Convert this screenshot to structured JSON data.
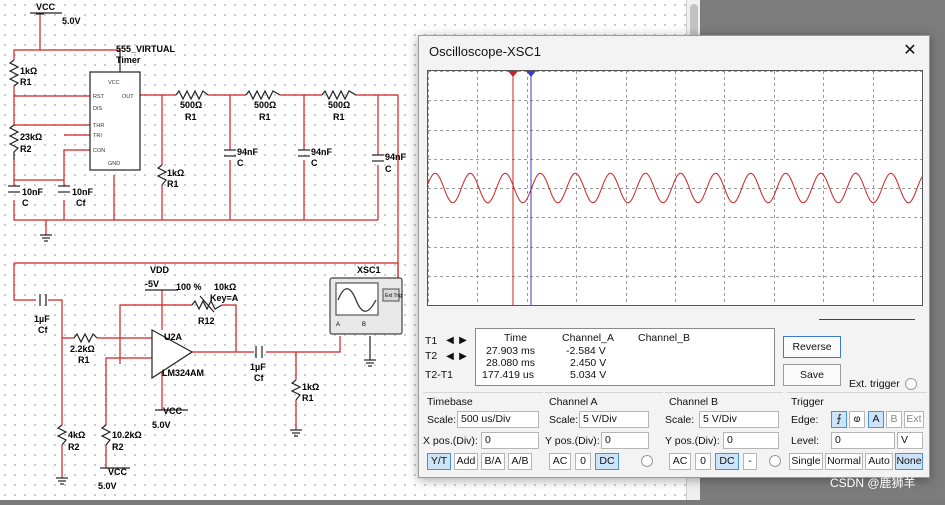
{
  "schematic": {
    "labels": {
      "vcc_top": "VCC",
      "vcc_top_val": "5.0V",
      "timer_name": "555_VIRTUAL",
      "timer_sub": "Timer",
      "pin_vcc": "VCC",
      "pin_rst": "RST",
      "pin_out": "OUT",
      "pin_dis": "DIS",
      "pin_thr": "THR",
      "pin_tri": "TRI",
      "pin_con": "CON",
      "pin_gnd": "GND",
      "r1_val": "1kΩ",
      "r1_name": "R1",
      "r2_val": "23kΩ",
      "r2_name": "R2",
      "c10_val": "10nF",
      "c10_name": "C",
      "cf10_val": "10nF",
      "cf10_name": "Cf",
      "rc1_val": "500Ω",
      "rc1_name": "R1",
      "rc2_val": "500Ω",
      "rc2_name": "R1",
      "rc3_val": "500Ω",
      "rc3_name": "R1",
      "c94a_val": "94nF",
      "c94a_name": "C",
      "c94b_val": "94nF",
      "c94b_name": "C",
      "c94c_val": "94nF",
      "c94c_name": "C",
      "rpd_val": "1kΩ",
      "rpd_name": "R1",
      "vdd": "VDD",
      "vdd_val": "-5V",
      "pot_pct": "100 %",
      "pot_val": "10kΩ",
      "pot_key": "Key=A",
      "pot_name": "R12",
      "cin_val": "1µF",
      "cin_name": "Cf",
      "rin_val": "2.2kΩ",
      "rin_name": "R1",
      "opamp_name": "U2A",
      "opamp_part": "LM324AM",
      "vcc2": "VCC",
      "vcc2_val": "5.0V",
      "cout_val": "1µF",
      "cout_name": "Cf",
      "rout_val": "1kΩ",
      "rout_name": "R1",
      "r4k_val": "4kΩ",
      "r4k_name": "R2",
      "r10k_val": "10.2kΩ",
      "r10k_name": "R2",
      "vcc3": "VCC",
      "vcc3_val": "5.0V",
      "xsc_name": "XSC1",
      "xsc_ext": "Ext Trig",
      "xsc_a": "A",
      "xsc_b": "B"
    }
  },
  "oscilloscope": {
    "title": "Oscilloscope-XSC1",
    "close": "✕",
    "trace_color": "#cc2222",
    "cursor1_color": "#cc2222",
    "cursor2_color": "#3a3ad0",
    "measurements": {
      "headers": [
        "Time",
        "Channel_A",
        "Channel_B"
      ],
      "rows": [
        {
          "label": "T1",
          "time": "27.903 ms",
          "a": "-2.584 V",
          "b": ""
        },
        {
          "label": "T2",
          "time": "28.080 ms",
          "a": "2.450 V",
          "b": ""
        },
        {
          "label": "T2-T1",
          "time": "177.419 us",
          "a": "5.034 V",
          "b": ""
        }
      ]
    },
    "buttons": {
      "reverse": "Reverse",
      "save": "Save",
      "ext_trigger": "Ext. trigger"
    },
    "timebase": {
      "title": "Timebase",
      "scale_label": "Scale:",
      "scale": "500 us/Div",
      "xpos_label": "X pos.(Div):",
      "xpos": "0",
      "modes": [
        "Y/T",
        "Add",
        "B/A",
        "A/B"
      ],
      "selected": "Y/T"
    },
    "channel_a": {
      "title": "Channel A",
      "scale_label": "Scale:",
      "scale": "5 V/Div",
      "ypos_label": "Y pos.(Div):",
      "ypos": "0",
      "coupling": [
        "AC",
        "0",
        "DC"
      ],
      "selected": "DC"
    },
    "channel_b": {
      "title": "Channel B",
      "scale_label": "Scale:",
      "scale": "5 V/Div",
      "ypos_label": "Y pos.(Div):",
      "ypos": "0",
      "coupling": [
        "AC",
        "0",
        "DC",
        "-"
      ],
      "selected": "DC"
    },
    "trigger": {
      "title": "Trigger",
      "edge_label": "Edge:",
      "level_label": "Level:",
      "level": "0",
      "level_unit": "V",
      "sources": [
        "A",
        "B",
        "Ext"
      ],
      "selected_source": "A",
      "modes": [
        "Single",
        "Normal",
        "Auto",
        "None"
      ],
      "selected_mode": "None"
    }
  },
  "watermark": "CSDN @鹿狮羊"
}
